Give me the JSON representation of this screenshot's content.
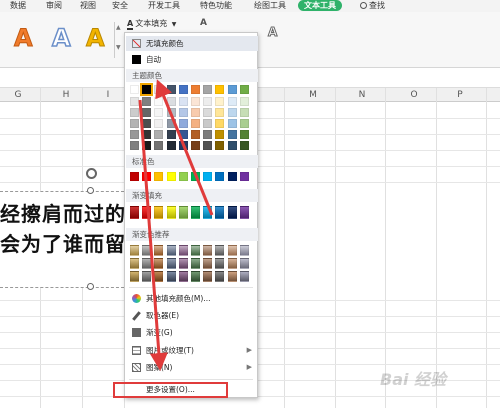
{
  "ribbon": {
    "tabs": [
      "数据",
      "审阅",
      "视图",
      "安全",
      "开发工具",
      "特色功能",
      "绘图工具",
      "文本工具"
    ],
    "active_tab": "文本工具",
    "search_label": "查找",
    "text_fill_label": "文本填充",
    "style_letters": [
      "A",
      "A",
      "A"
    ],
    "style_colors": [
      "#f07b2b",
      "#6b8fc9",
      "#f2b400"
    ],
    "accent": "#2fb26a"
  },
  "columns": [
    "G",
    "H",
    "I",
    "M",
    "N",
    "O",
    "P"
  ],
  "textbox": {
    "line1": "经擦肩而过的",
    "line2": "会为了谁而留"
  },
  "fill_menu": {
    "no_fill": "无填充颜色",
    "auto": "自动",
    "theme_colors_label": "主题颜色",
    "standard_colors_label": "标准色",
    "gradient_fill_label": "渐变填充",
    "gradient_recommend_label": "渐变色推荐",
    "more_fill_colors": "其他填充颜色(M)...",
    "eyedropper": "取色器(E)",
    "gradient": "渐变(G)",
    "picture_texture": "图片或纹理(T)",
    "pattern": "图案(N)",
    "more_settings": "更多设置(O)...",
    "standard_colors": [
      "#c00000",
      "#ff0000",
      "#ffc000",
      "#ffff00",
      "#92d050",
      "#00b050",
      "#00b0f0",
      "#0070c0",
      "#002060",
      "#7030a0"
    ],
    "gradient_colors": [
      "#c00000",
      "#ff0000",
      "#ffc000",
      "#ffff00",
      "#92d050",
      "#00b050",
      "#00b0f0",
      "#0070c0",
      "#002060",
      "#7030a0"
    ],
    "theme_top_row": [
      "#ffffff",
      "#000000",
      "#e7e6e6",
      "#44546a",
      "#4472c4",
      "#ed7d31",
      "#a5a5a5",
      "#ffc000",
      "#5b9bd5",
      "#70ad47"
    ],
    "annotation_color": "#e03b3b"
  },
  "watermark": "Bai 经验"
}
